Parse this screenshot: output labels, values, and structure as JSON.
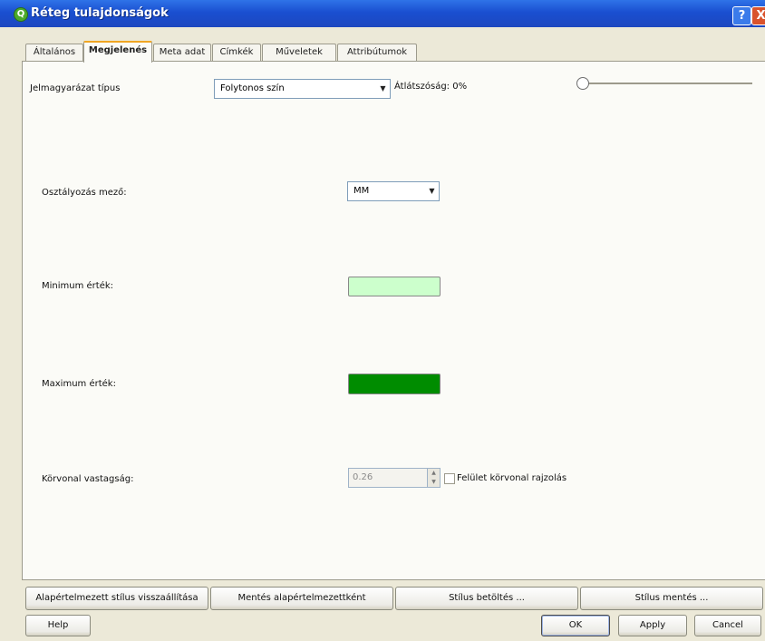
{
  "window": {
    "title": "Réteg tulajdonságok",
    "app_icon": "Q",
    "help_glyph": "?",
    "close_glyph": "X"
  },
  "tabs": [
    {
      "label": "Általános"
    },
    {
      "label": "Megjelenés",
      "active": true
    },
    {
      "label": "Meta adat"
    },
    {
      "label": "Címkék"
    },
    {
      "label": "Műveletek"
    },
    {
      "label": "Attribútumok"
    }
  ],
  "appearance": {
    "legend_type_label": "Jelmagyarázat típus",
    "legend_type_value": "Folytonos szín",
    "transparency_label": "Átlátszóság: 0%",
    "transparency_percent": 0,
    "classification_field_label": "Osztályozás mező:",
    "classification_field_value": "MM",
    "minimum_value_label": "Minimum érték:",
    "minimum_color": "#ccffcc",
    "maximum_value_label": "Maximum érték:",
    "maximum_color": "#008c00",
    "outline_width_label": "Körvonal vastagság:",
    "outline_width_value": "0.26",
    "polygon_outline_checkbox_label": "Felület körvonal rajzolás",
    "polygon_outline_checked": false
  },
  "style_buttons": {
    "restore_default": "Alapértelmezett stílus visszaállítása",
    "save_as_default": "Mentés alapértelmezettként",
    "load_style": "Stílus betöltés ...",
    "save_style": "Stílus mentés ..."
  },
  "dialog_buttons": {
    "help": "Help",
    "ok": "OK",
    "apply": "Apply",
    "cancel": "Cancel"
  },
  "arrow_glyph": "▼"
}
